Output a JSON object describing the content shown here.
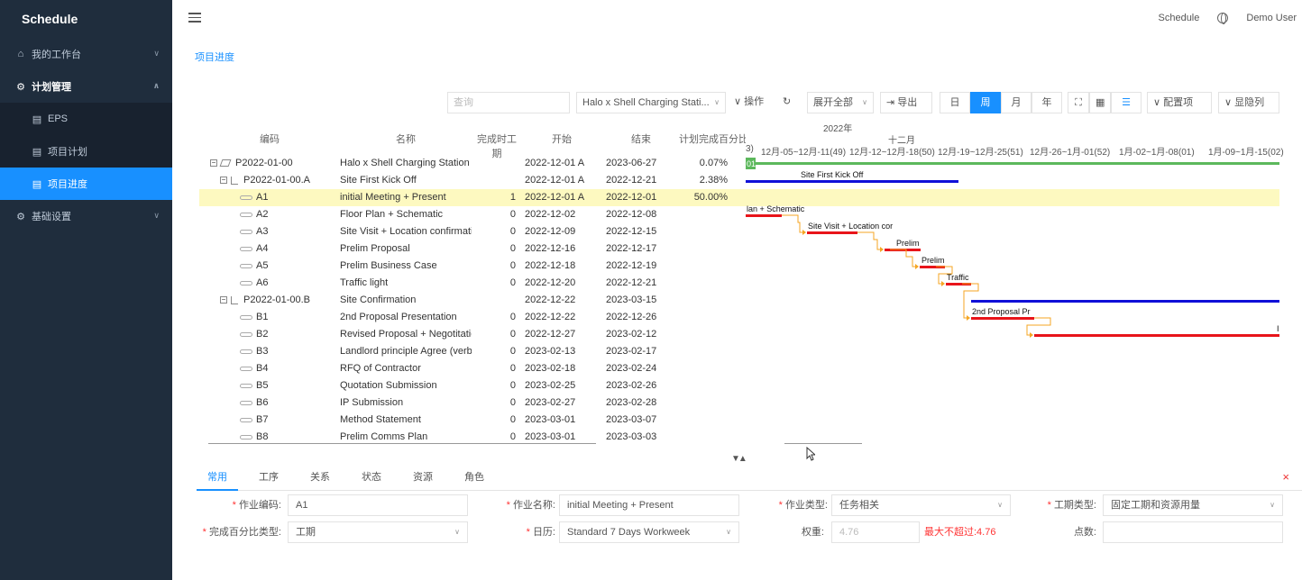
{
  "app": {
    "title": "Schedule"
  },
  "header": {
    "app_link": "Schedule",
    "user": "Demo User"
  },
  "sidebar": {
    "workbench": "我的工作台",
    "plan_mgmt": "计划管理",
    "sub": {
      "eps": "EPS",
      "project_plan": "项目计划",
      "project_progress": "项目进度"
    },
    "basic_settings": "基础设置"
  },
  "breadcrumb": "项目进度",
  "toolbar": {
    "search_placeholder": "查询",
    "project_select": "Halo x Shell Charging Stati...",
    "operations": "操作",
    "expand_all": "展开全部",
    "export": "导出",
    "day": "日",
    "week": "周",
    "month": "月",
    "year": "年",
    "config": "配置项",
    "hidden_cols": "显隐列"
  },
  "table": {
    "headers": {
      "code": "编码",
      "name": "名称",
      "duration": "完成时工期",
      "start": "开始",
      "end": "结束",
      "pct": "计划完成百分比(实际)"
    },
    "rows": [
      {
        "code": "P2022-01-00",
        "name": "Halo x Shell Charging Station EP",
        "duration": "",
        "start": "2022-12-01 A",
        "end": "2023-06-27",
        "pct": "0.07%"
      },
      {
        "code": "P2022-01-00.A",
        "name": "Site First Kick Off",
        "duration": "",
        "start": "2022-12-01 A",
        "end": "2022-12-21",
        "pct": "2.38%"
      },
      {
        "code": "A1",
        "name": "initial Meeting + Present",
        "duration": "1",
        "start": "2022-12-01 A",
        "end": "2022-12-01",
        "pct": "50.00%"
      },
      {
        "code": "A2",
        "name": "Floor Plan + Schematic",
        "duration": "0",
        "start": "2022-12-02",
        "end": "2022-12-08",
        "pct": ""
      },
      {
        "code": "A3",
        "name": "Site Visit + Location confirmation",
        "duration": "0",
        "start": "2022-12-09",
        "end": "2022-12-15",
        "pct": ""
      },
      {
        "code": "A4",
        "name": "Prelim Proposal",
        "duration": "0",
        "start": "2022-12-16",
        "end": "2022-12-17",
        "pct": ""
      },
      {
        "code": "A5",
        "name": "Prelim Business Case",
        "duration": "0",
        "start": "2022-12-18",
        "end": "2022-12-19",
        "pct": ""
      },
      {
        "code": "A6",
        "name": "Traffic light",
        "duration": "0",
        "start": "2022-12-20",
        "end": "2022-12-21",
        "pct": ""
      },
      {
        "code": "P2022-01-00.B",
        "name": "Site Confirmation",
        "duration": "",
        "start": "2022-12-22",
        "end": "2023-03-15",
        "pct": ""
      },
      {
        "code": "B1",
        "name": "2nd Proposal Presentation",
        "duration": "0",
        "start": "2022-12-22",
        "end": "2022-12-26",
        "pct": ""
      },
      {
        "code": "B2",
        "name": "Revised Proposal + Negotitation",
        "duration": "0",
        "start": "2022-12-27",
        "end": "2023-02-12",
        "pct": ""
      },
      {
        "code": "B3",
        "name": "Landlord principle Agree (verbal /",
        "duration": "0",
        "start": "2023-02-13",
        "end": "2023-02-17",
        "pct": ""
      },
      {
        "code": "B4",
        "name": "RFQ of Contractor",
        "duration": "0",
        "start": "2023-02-18",
        "end": "2023-02-24",
        "pct": ""
      },
      {
        "code": "B5",
        "name": "Quotation Submission",
        "duration": "0",
        "start": "2023-02-25",
        "end": "2023-02-26",
        "pct": ""
      },
      {
        "code": "B6",
        "name": "IP Submission",
        "duration": "0",
        "start": "2023-02-27",
        "end": "2023-02-28",
        "pct": ""
      },
      {
        "code": "B7",
        "name": "Method Statement",
        "duration": "0",
        "start": "2023-03-01",
        "end": "2023-03-07",
        "pct": ""
      },
      {
        "code": "B8",
        "name": "Prelim Comms Plan",
        "duration": "0",
        "start": "2023-03-01",
        "end": "2023-03-03",
        "pct": ""
      }
    ]
  },
  "gantt": {
    "year": "2022年",
    "month": "十二月",
    "weeks": [
      "3)",
      "12月-05~12月-11(49)",
      "12月-12~12月-18(50)",
      "12月-19~12月-25(51)",
      "12月-26~1月-01(52)",
      "1月-02~1月-08(01)",
      "1月-09~1月-15(02)"
    ],
    "labels": {
      "p01": "01",
      "kickoff": "Site First Kick Off",
      "a2": "lan + Schematic",
      "a3": "Site Visit + Location cor",
      "a4": "Prelim",
      "a5": "Prelim",
      "a6": "Traffic",
      "b1": "2nd Proposal Pr",
      "b2": "I"
    },
    "colors": {
      "project": "#5cb85c",
      "summary": "#1010d8",
      "task": "#e8141a",
      "link": "#f5a623",
      "highlight": "#fdf9c0"
    }
  },
  "tabs": [
    "常用",
    "工序",
    "关系",
    "状态",
    "资源",
    "角色"
  ],
  "form": {
    "code_label": "作业编码:",
    "code_value": "A1",
    "name_label": "作业名称:",
    "name_value": "initial Meeting + Present",
    "type_label": "作业类型:",
    "type_value": "任务相关",
    "dur_type_label": "工期类型:",
    "dur_type_value": "固定工期和资源用量",
    "pct_type_label": "完成百分比类型:",
    "pct_type_value": "工期",
    "calendar_label": "日历:",
    "calendar_value": "Standard 7 Days Workweek",
    "weight_label": "权重:",
    "weight_value": "4.76",
    "weight_warning": "最大不超过:4.76",
    "points_label": "点数:",
    "points_value": ""
  }
}
